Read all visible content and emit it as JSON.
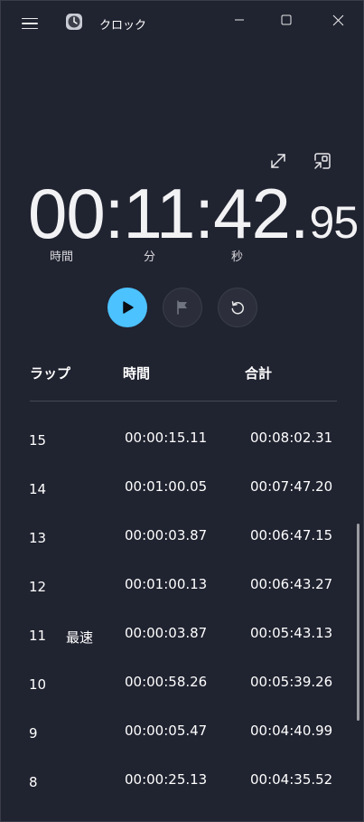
{
  "window": {
    "title": "クロック"
  },
  "stopwatch": {
    "time_main": "00:11:42.",
    "time_fraction": "95",
    "units": {
      "hours": "時間",
      "minutes": "分",
      "seconds": "秒"
    }
  },
  "laps": {
    "headers": {
      "lap": "ラップ",
      "time": "時間",
      "total": "合計"
    },
    "rows": [
      {
        "num": "15",
        "tag": "",
        "time": "00:00:15.11",
        "total": "00:08:02.31"
      },
      {
        "num": "14",
        "tag": "",
        "time": "00:01:00.05",
        "total": "00:07:47.20"
      },
      {
        "num": "13",
        "tag": "",
        "time": "00:00:03.87",
        "total": "00:06:47.15"
      },
      {
        "num": "12",
        "tag": "",
        "time": "00:01:00.13",
        "total": "00:06:43.27"
      },
      {
        "num": "11",
        "tag": "最速",
        "time": "00:00:03.87",
        "total": "00:05:43.13"
      },
      {
        "num": "10",
        "tag": "",
        "time": "00:00:58.26",
        "total": "00:05:39.26"
      },
      {
        "num": "9",
        "tag": "",
        "time": "00:00:05.47",
        "total": "00:04:40.99"
      },
      {
        "num": "8",
        "tag": "",
        "time": "00:00:25.13",
        "total": "00:04:35.52"
      }
    ]
  },
  "icons": {
    "menu": "hamburger-menu-icon",
    "app": "clock-app-icon",
    "minimize": "minimize-icon",
    "maximize": "maximize-icon",
    "close": "close-icon",
    "expand": "expand-icon",
    "compact_overlay": "compact-overlay-icon",
    "play": "play-icon",
    "lap": "flag-icon",
    "reset": "reset-icon"
  },
  "colors": {
    "background": "#202330",
    "accent": "#4cc2ff"
  }
}
